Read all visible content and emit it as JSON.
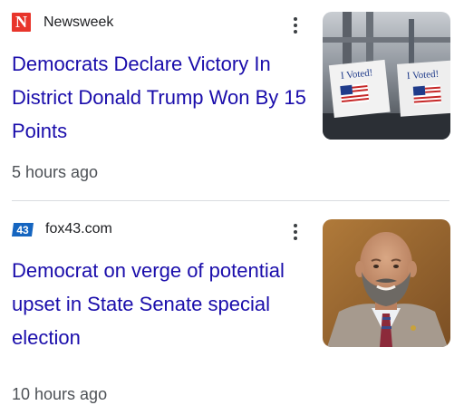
{
  "articles": [
    {
      "source": {
        "name": "Newsweek",
        "logo_letter": "N",
        "logo_color": "#e8352b"
      },
      "headline": "Democrats Declare Victory In District Donald Trump Won By 15 Points",
      "time": "5 hours ago",
      "thumbnail": {
        "sticker_text": "I Voted!"
      }
    },
    {
      "source": {
        "name": "fox43.com",
        "logo_text": "43",
        "logo_color": "#1565c0"
      },
      "headline": "Democrat on verge of potential upset in State Senate special election",
      "time": "10 hours ago"
    }
  ],
  "colors": {
    "link": "#1a0dab",
    "meta": "#4d5156",
    "divider": "#dadce0"
  },
  "icons": {
    "menu": "more-vert-icon"
  }
}
